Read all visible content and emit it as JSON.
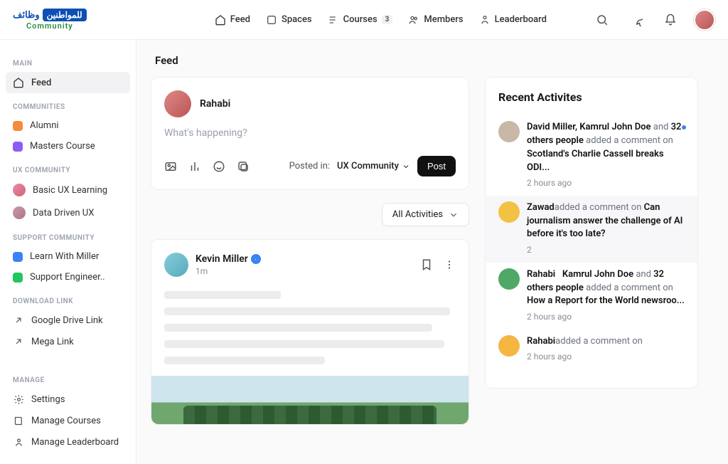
{
  "logo": {
    "pill": "للمواطنين",
    "arabic": "وظائف",
    "sub": "Community"
  },
  "topnav": {
    "feed": "Feed",
    "spaces": "Spaces",
    "courses": "Courses",
    "courses_badge": "3",
    "members": "Members",
    "leaderboard": "Leaderboard"
  },
  "page_title": "Feed",
  "sidebar": {
    "main_header": "MAIN",
    "feed": "Feed",
    "communities_header": "COMMUNITIES",
    "alumni": "Alumni",
    "masters": "Masters Course",
    "ux_header": "UX COMMUNITY",
    "basic_ux": "Basic UX Learning",
    "data_ux": "Data Driven UX",
    "support_header": "SUPPORT COMMUNITY",
    "learn_miller": "Learn With Miller",
    "support_eng": "Support Engineer..",
    "download_header": "DOWNLOAD LINK",
    "gdrive": "Google Drive Link",
    "mega": "Mega Link",
    "manage_header": "MANAGE",
    "settings": "Settings",
    "manage_courses": "Manage Courses",
    "manage_leaderboard": "Manage Leaderboard"
  },
  "composer": {
    "name": "Rahabi",
    "placeholder": "What's happening?",
    "posted_in_label": "Posted in:",
    "posted_in_value": "UX Community",
    "post_button": "Post"
  },
  "filter": {
    "label": "All Activities"
  },
  "post": {
    "author": "Kevin Miller",
    "time": "1m"
  },
  "activity": {
    "title": "Recent Activites",
    "items": [
      {
        "people": "David Miller, Kamrul John Doe",
        "and": " and ",
        "others": "32 others people",
        "action": " added a comment on ",
        "target": "Scotland's Charlie Cassell breaks ODI...",
        "time": "2 hours ago",
        "unread": true,
        "avcolor": "#c9b8a6"
      },
      {
        "people": "Zawad",
        "and": "",
        "others": "",
        "action": "added a comment on ",
        "target": "Can journalism answer the challenge of AI before it's too late?",
        "time": "2",
        "unread": false,
        "highlight": true,
        "avcolor": "#f2c244"
      },
      {
        "people": "Rahabi",
        "mid": "Kamrul John Doe",
        "and": " and ",
        "others": "32 others people",
        "action": " added a comment on ",
        "target": "How a Report for the World newsroo...",
        "time": "2 hours ago",
        "unread": false,
        "avcolor": "#4fa867"
      },
      {
        "people": "Rahabi",
        "and": "",
        "others": "",
        "action": "added a comment on",
        "target": "",
        "time": "2 hours ago",
        "unread": false,
        "avcolor": "#f5b642"
      }
    ]
  }
}
